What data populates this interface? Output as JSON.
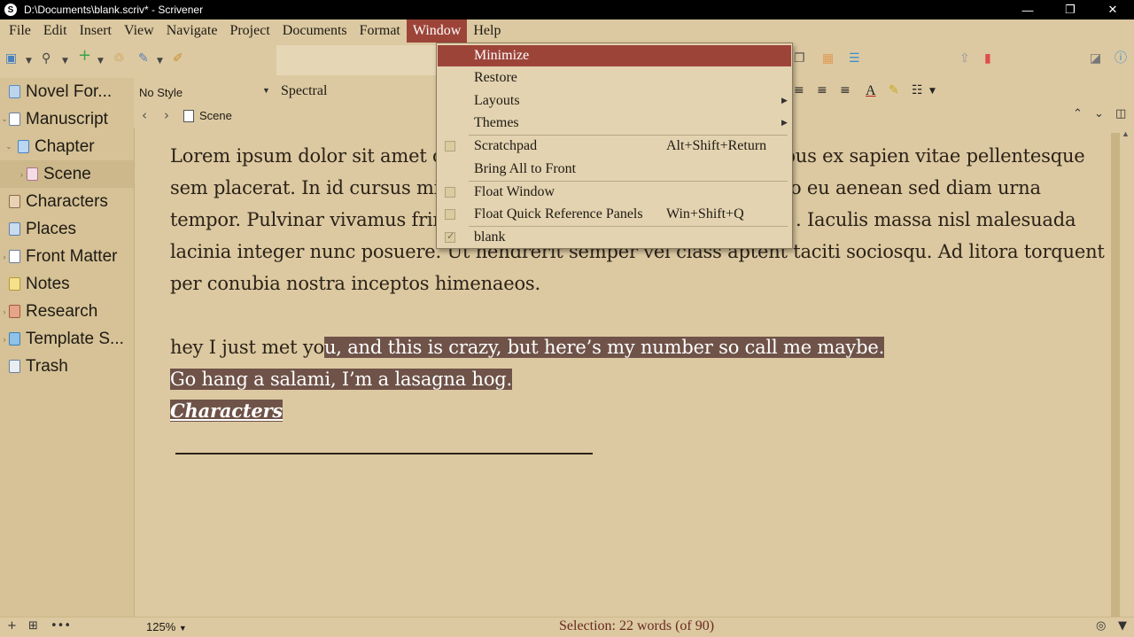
{
  "window": {
    "title": "D:\\Documents\\blank.scriv* - Scrivener",
    "app_icon": "S",
    "buttons": [
      "—",
      "❐",
      "✕"
    ]
  },
  "menubar": {
    "items": [
      "File",
      "Edit",
      "Insert",
      "View",
      "Navigate",
      "Project",
      "Documents",
      "Format",
      "Window",
      "Help"
    ],
    "active": "Window"
  },
  "binder": {
    "items": [
      {
        "label": "Novel For...",
        "icon": "warning-icon"
      },
      {
        "label": "Manuscript",
        "icon": "manuscript-icon"
      },
      {
        "label": "Chapter",
        "icon": "folder-icon"
      },
      {
        "label": "Scene",
        "icon": "document-icon"
      },
      {
        "label": "Characters",
        "icon": "characters-icon"
      },
      {
        "label": "Places",
        "icon": "places-icon"
      },
      {
        "label": "Front Matter",
        "icon": "front-matter-icon"
      },
      {
        "label": "Notes",
        "icon": "notes-icon"
      },
      {
        "label": "Research",
        "icon": "research-icon"
      },
      {
        "label": "Template S...",
        "icon": "template-icon"
      },
      {
        "label": "Trash",
        "icon": "trash-icon"
      }
    ]
  },
  "formatbar": {
    "style": "No Style",
    "font": "Spectral"
  },
  "header": {
    "document_title": "Scene"
  },
  "editor": {
    "p1_words": [
      "Lorem",
      " ",
      "ipsum",
      " dolor sit ",
      "amet",
      " c",
      "ibus",
      " ex ",
      "sapien",
      " vitae ",
      "pellentesque"
    ],
    "line1_a": "Lorem ipsum dolor sit amet c",
    "line1_b": "ibus ex sapien vitae pellentesque",
    "line2_a": "sem placerat. In id cursus mi",
    "line2_b": "o eu aenean sed diam urna",
    "line3_a": "tempor. Pulvinar vivamus frin",
    "line3_b": ". Iaculis massa nisl malesuada",
    "line4": "lacinia integer nunc posuere. Ut hendrerit semper vel class aptent taciti sociosqu. Ad litora torquent",
    "line5": "per conubia nostra inceptos himenaeos.",
    "line6_plain": "hey I just met yo",
    "line6_sel": "u, and this is crazy, but here’s my number so call me maybe. ",
    "line7_sel": "Go hang a salami, I’m a lasagna hog.",
    "line8_sel": "Characters"
  },
  "footer": {
    "zoom": "125%",
    "selection": "Selection: 22 words (of 90)"
  },
  "window_menu": {
    "items": [
      {
        "label": "Minimize",
        "shortcut": "",
        "check": false,
        "submenu": false,
        "highlighted": true
      },
      {
        "label": "Restore",
        "shortcut": "",
        "check": false,
        "submenu": false,
        "highlighted": false
      },
      {
        "label": "Layouts",
        "shortcut": "",
        "check": false,
        "submenu": true,
        "highlighted": false
      },
      {
        "label": "Themes",
        "shortcut": "",
        "check": false,
        "submenu": true,
        "highlighted": false
      },
      {
        "label": "Scratchpad",
        "shortcut": "Alt+Shift+Return",
        "check": "box",
        "submenu": false,
        "highlighted": false
      },
      {
        "label": "Bring All to Front",
        "shortcut": "",
        "check": false,
        "submenu": false,
        "highlighted": false
      },
      {
        "label": "Float Window",
        "shortcut": "",
        "check": "box",
        "submenu": false,
        "highlighted": false
      },
      {
        "label": "Float Quick Reference Panels",
        "shortcut": "Win+Shift+Q",
        "check": "box",
        "submenu": false,
        "highlighted": false
      },
      {
        "label": "blank",
        "shortcut": "",
        "check": "checked",
        "submenu": false,
        "highlighted": false
      }
    ]
  },
  "colors": {
    "background": "#dcc9a1",
    "binder": "#d6c296",
    "accent": "#9d4439",
    "selection": "#6f5348"
  }
}
